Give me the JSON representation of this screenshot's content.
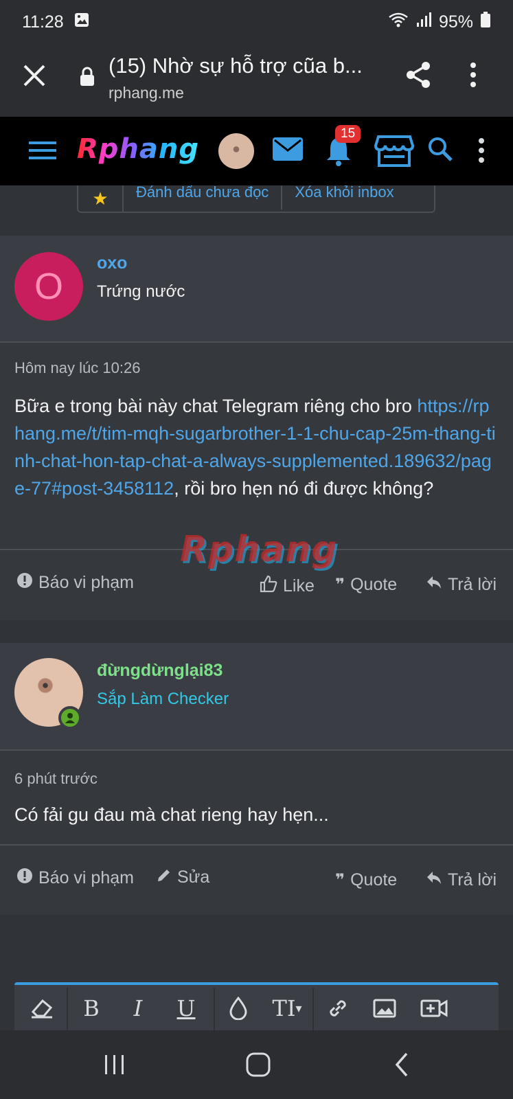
{
  "status": {
    "time": "11:28",
    "battery": "95%"
  },
  "browser": {
    "title": "(15) Nhờ sự hỗ trợ cũa b...",
    "domain": "rphang.me"
  },
  "site": {
    "logo": "Rphang",
    "notif_count": "15"
  },
  "actions": {
    "mark_unread": "Đánh dấu chưa đọc",
    "remove_inbox": "Xóa khỏi inbox"
  },
  "posts": [
    {
      "avatar_letter": "O",
      "username": "oxo",
      "user_title": "Trứng nước",
      "date": "Hôm nay lúc 10:26",
      "message_pre": "Bữa e trong bài này chat Telegram riêng cho bro ",
      "link": "https://rphang.me/t/tim-mqh-sugarbrother-1-1-chu-cap-25m-thang-tinh-chat-hon-tap-chat-a-always-supplemented.189632/page-77#post-3458112",
      "message_post": ", rồi bro hẹn nó đi được không?",
      "report": "Báo vi phạm",
      "like": "Like",
      "quote": "Quote",
      "reply": "Trả lời"
    },
    {
      "username": "đừngdừnglại83",
      "user_title": "Sắp Làm Checker",
      "date": "6 phút trước",
      "message": "Có fải gu đau mà chat rieng hay hẹn...",
      "report": "Báo vi phạm",
      "edit": "Sửa",
      "quote": "Quote",
      "reply": "Trả lời"
    }
  ],
  "watermark": "Rphang",
  "colors": {
    "link": "#4fa6e8",
    "user1": "#4fa6e8",
    "user2": "#7ee08a",
    "title2": "#32c8e6",
    "accent": "#3d9be0"
  }
}
